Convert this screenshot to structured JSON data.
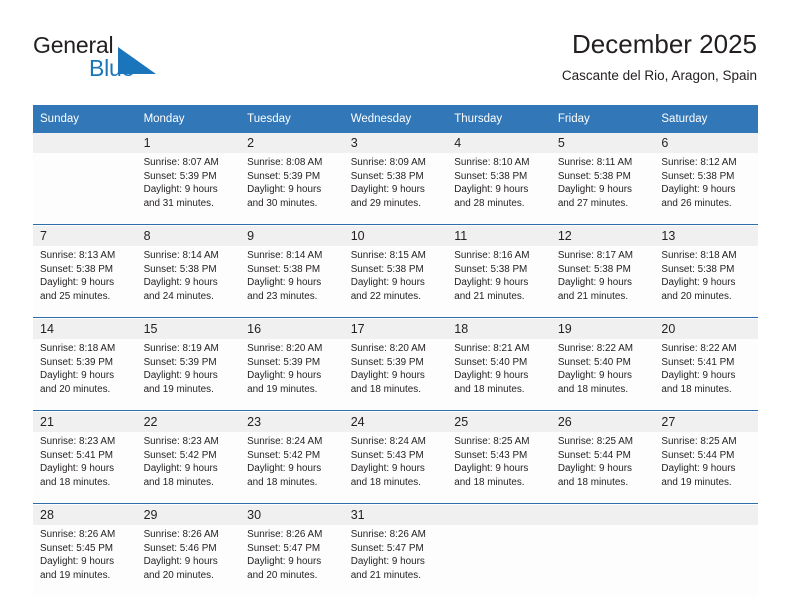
{
  "brand": {
    "name_part1": "General",
    "name_part2": "Blue"
  },
  "header": {
    "title": "December 2025",
    "subtitle": "Cascante del Rio, Aragon, Spain"
  },
  "colors": {
    "header_blue": "#3277b8",
    "separator_blue": "#2f6eac",
    "daynum_band": "#f0f0f0",
    "brand_blue": "#1b75bb",
    "text": "#231f20"
  },
  "weekday_headers": [
    "Sunday",
    "Monday",
    "Tuesday",
    "Wednesday",
    "Thursday",
    "Friday",
    "Saturday"
  ],
  "weeks": [
    {
      "days": [
        {
          "num": "",
          "sunrise": "",
          "sunset": "",
          "daylight1": "",
          "daylight2": ""
        },
        {
          "num": "1",
          "sunrise": "Sunrise: 8:07 AM",
          "sunset": "Sunset: 5:39 PM",
          "daylight1": "Daylight: 9 hours",
          "daylight2": "and 31 minutes."
        },
        {
          "num": "2",
          "sunrise": "Sunrise: 8:08 AM",
          "sunset": "Sunset: 5:39 PM",
          "daylight1": "Daylight: 9 hours",
          "daylight2": "and 30 minutes."
        },
        {
          "num": "3",
          "sunrise": "Sunrise: 8:09 AM",
          "sunset": "Sunset: 5:38 PM",
          "daylight1": "Daylight: 9 hours",
          "daylight2": "and 29 minutes."
        },
        {
          "num": "4",
          "sunrise": "Sunrise: 8:10 AM",
          "sunset": "Sunset: 5:38 PM",
          "daylight1": "Daylight: 9 hours",
          "daylight2": "and 28 minutes."
        },
        {
          "num": "5",
          "sunrise": "Sunrise: 8:11 AM",
          "sunset": "Sunset: 5:38 PM",
          "daylight1": "Daylight: 9 hours",
          "daylight2": "and 27 minutes."
        },
        {
          "num": "6",
          "sunrise": "Sunrise: 8:12 AM",
          "sunset": "Sunset: 5:38 PM",
          "daylight1": "Daylight: 9 hours",
          "daylight2": "and 26 minutes."
        }
      ]
    },
    {
      "days": [
        {
          "num": "7",
          "sunrise": "Sunrise: 8:13 AM",
          "sunset": "Sunset: 5:38 PM",
          "daylight1": "Daylight: 9 hours",
          "daylight2": "and 25 minutes."
        },
        {
          "num": "8",
          "sunrise": "Sunrise: 8:14 AM",
          "sunset": "Sunset: 5:38 PM",
          "daylight1": "Daylight: 9 hours",
          "daylight2": "and 24 minutes."
        },
        {
          "num": "9",
          "sunrise": "Sunrise: 8:14 AM",
          "sunset": "Sunset: 5:38 PM",
          "daylight1": "Daylight: 9 hours",
          "daylight2": "and 23 minutes."
        },
        {
          "num": "10",
          "sunrise": "Sunrise: 8:15 AM",
          "sunset": "Sunset: 5:38 PM",
          "daylight1": "Daylight: 9 hours",
          "daylight2": "and 22 minutes."
        },
        {
          "num": "11",
          "sunrise": "Sunrise: 8:16 AM",
          "sunset": "Sunset: 5:38 PM",
          "daylight1": "Daylight: 9 hours",
          "daylight2": "and 21 minutes."
        },
        {
          "num": "12",
          "sunrise": "Sunrise: 8:17 AM",
          "sunset": "Sunset: 5:38 PM",
          "daylight1": "Daylight: 9 hours",
          "daylight2": "and 21 minutes."
        },
        {
          "num": "13",
          "sunrise": "Sunrise: 8:18 AM",
          "sunset": "Sunset: 5:38 PM",
          "daylight1": "Daylight: 9 hours",
          "daylight2": "and 20 minutes."
        }
      ]
    },
    {
      "days": [
        {
          "num": "14",
          "sunrise": "Sunrise: 8:18 AM",
          "sunset": "Sunset: 5:39 PM",
          "daylight1": "Daylight: 9 hours",
          "daylight2": "and 20 minutes."
        },
        {
          "num": "15",
          "sunrise": "Sunrise: 8:19 AM",
          "sunset": "Sunset: 5:39 PM",
          "daylight1": "Daylight: 9 hours",
          "daylight2": "and 19 minutes."
        },
        {
          "num": "16",
          "sunrise": "Sunrise: 8:20 AM",
          "sunset": "Sunset: 5:39 PM",
          "daylight1": "Daylight: 9 hours",
          "daylight2": "and 19 minutes."
        },
        {
          "num": "17",
          "sunrise": "Sunrise: 8:20 AM",
          "sunset": "Sunset: 5:39 PM",
          "daylight1": "Daylight: 9 hours",
          "daylight2": "and 18 minutes."
        },
        {
          "num": "18",
          "sunrise": "Sunrise: 8:21 AM",
          "sunset": "Sunset: 5:40 PM",
          "daylight1": "Daylight: 9 hours",
          "daylight2": "and 18 minutes."
        },
        {
          "num": "19",
          "sunrise": "Sunrise: 8:22 AM",
          "sunset": "Sunset: 5:40 PM",
          "daylight1": "Daylight: 9 hours",
          "daylight2": "and 18 minutes."
        },
        {
          "num": "20",
          "sunrise": "Sunrise: 8:22 AM",
          "sunset": "Sunset: 5:41 PM",
          "daylight1": "Daylight: 9 hours",
          "daylight2": "and 18 minutes."
        }
      ]
    },
    {
      "days": [
        {
          "num": "21",
          "sunrise": "Sunrise: 8:23 AM",
          "sunset": "Sunset: 5:41 PM",
          "daylight1": "Daylight: 9 hours",
          "daylight2": "and 18 minutes."
        },
        {
          "num": "22",
          "sunrise": "Sunrise: 8:23 AM",
          "sunset": "Sunset: 5:42 PM",
          "daylight1": "Daylight: 9 hours",
          "daylight2": "and 18 minutes."
        },
        {
          "num": "23",
          "sunrise": "Sunrise: 8:24 AM",
          "sunset": "Sunset: 5:42 PM",
          "daylight1": "Daylight: 9 hours",
          "daylight2": "and 18 minutes."
        },
        {
          "num": "24",
          "sunrise": "Sunrise: 8:24 AM",
          "sunset": "Sunset: 5:43 PM",
          "daylight1": "Daylight: 9 hours",
          "daylight2": "and 18 minutes."
        },
        {
          "num": "25",
          "sunrise": "Sunrise: 8:25 AM",
          "sunset": "Sunset: 5:43 PM",
          "daylight1": "Daylight: 9 hours",
          "daylight2": "and 18 minutes."
        },
        {
          "num": "26",
          "sunrise": "Sunrise: 8:25 AM",
          "sunset": "Sunset: 5:44 PM",
          "daylight1": "Daylight: 9 hours",
          "daylight2": "and 18 minutes."
        },
        {
          "num": "27",
          "sunrise": "Sunrise: 8:25 AM",
          "sunset": "Sunset: 5:44 PM",
          "daylight1": "Daylight: 9 hours",
          "daylight2": "and 19 minutes."
        }
      ]
    },
    {
      "days": [
        {
          "num": "28",
          "sunrise": "Sunrise: 8:26 AM",
          "sunset": "Sunset: 5:45 PM",
          "daylight1": "Daylight: 9 hours",
          "daylight2": "and 19 minutes."
        },
        {
          "num": "29",
          "sunrise": "Sunrise: 8:26 AM",
          "sunset": "Sunset: 5:46 PM",
          "daylight1": "Daylight: 9 hours",
          "daylight2": "and 20 minutes."
        },
        {
          "num": "30",
          "sunrise": "Sunrise: 8:26 AM",
          "sunset": "Sunset: 5:47 PM",
          "daylight1": "Daylight: 9 hours",
          "daylight2": "and 20 minutes."
        },
        {
          "num": "31",
          "sunrise": "Sunrise: 8:26 AM",
          "sunset": "Sunset: 5:47 PM",
          "daylight1": "Daylight: 9 hours",
          "daylight2": "and 21 minutes."
        },
        {
          "num": "",
          "sunrise": "",
          "sunset": "",
          "daylight1": "",
          "daylight2": ""
        },
        {
          "num": "",
          "sunrise": "",
          "sunset": "",
          "daylight1": "",
          "daylight2": ""
        },
        {
          "num": "",
          "sunrise": "",
          "sunset": "",
          "daylight1": "",
          "daylight2": ""
        }
      ]
    }
  ]
}
